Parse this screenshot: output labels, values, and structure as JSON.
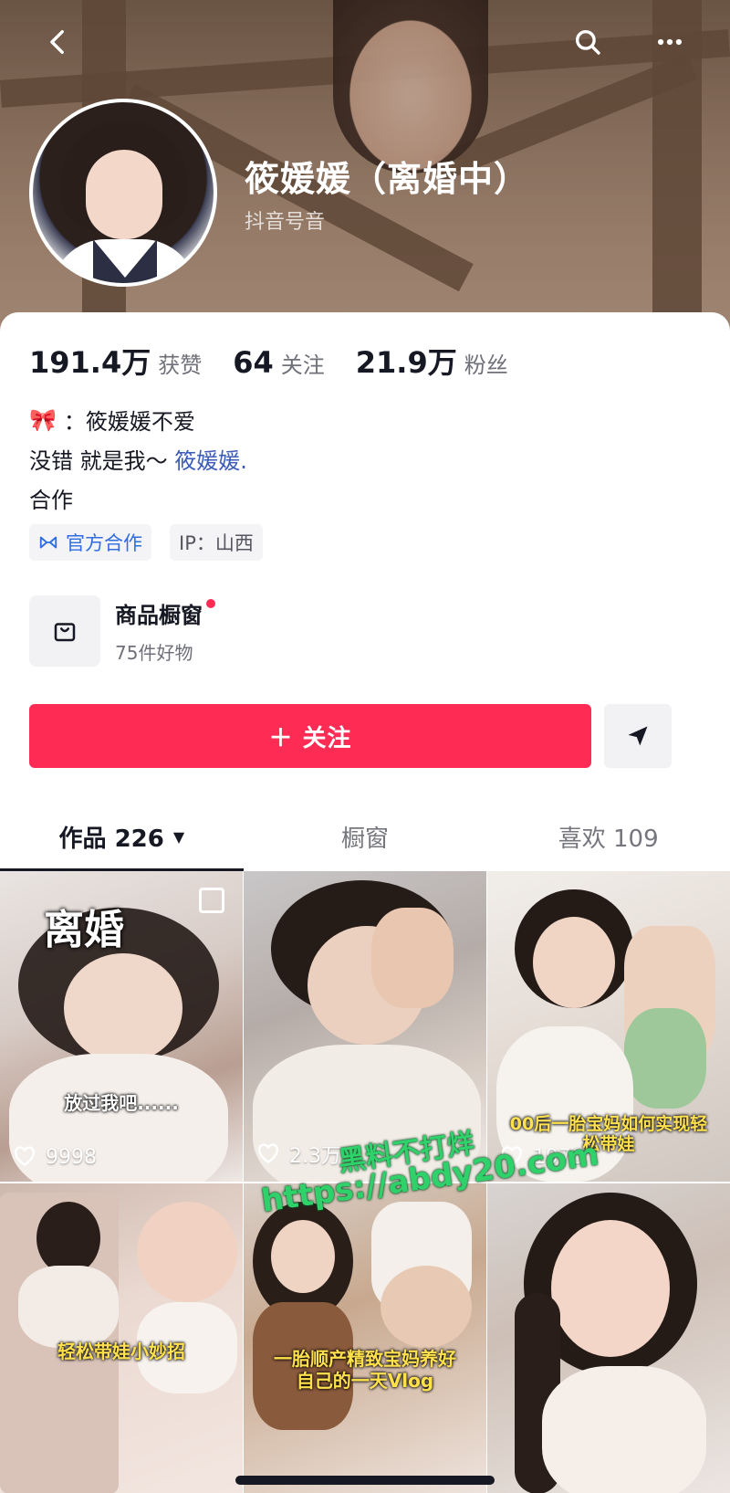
{
  "header": {
    "name": "筱媛媛（离婚中）",
    "douyin_id": "抖音号音"
  },
  "stats": [
    {
      "value": "191.4万",
      "label": "获赞"
    },
    {
      "value": "64",
      "label": "关注"
    },
    {
      "value": "21.9万",
      "label": "粉丝"
    }
  ],
  "bio": {
    "line1": "：筱媛媛不爱",
    "line2_prefix": "没错 就是我～",
    "line2_mention": "筱媛媛.",
    "line3": "合作"
  },
  "tags": {
    "cooperation": "官方合作",
    "ip": "IP：山西"
  },
  "shop": {
    "title": "商品橱窗",
    "subtitle": "75件好物"
  },
  "actions": {
    "follow": "＋ 关注"
  },
  "tabs": [
    {
      "label": "作品 226",
      "active": true
    },
    {
      "label": "橱窗",
      "active": false
    },
    {
      "label": "喜欢 109",
      "active": false
    }
  ],
  "videos": [
    {
      "title": "离婚",
      "caption": "放过我吧......",
      "likes": "9998"
    },
    {
      "caption": "",
      "likes": "2.3万"
    },
    {
      "caption": "00后一胎宝妈如何实现轻松带娃",
      "likes": "1970"
    },
    {
      "caption": "轻松带娃小妙招",
      "likes": ""
    },
    {
      "caption": "一胎顺产精致宝妈养好自己的一天Vlog",
      "likes": ""
    },
    {
      "caption": "",
      "likes": ""
    }
  ],
  "watermark": {
    "line1": "黑料不打烊",
    "line2": "https://abdy20.com"
  },
  "colors": {
    "primary": "#fe2c55",
    "link": "#3a5bb8",
    "tag_blue": "#2f6de1",
    "watermark": "#2fd26a"
  }
}
